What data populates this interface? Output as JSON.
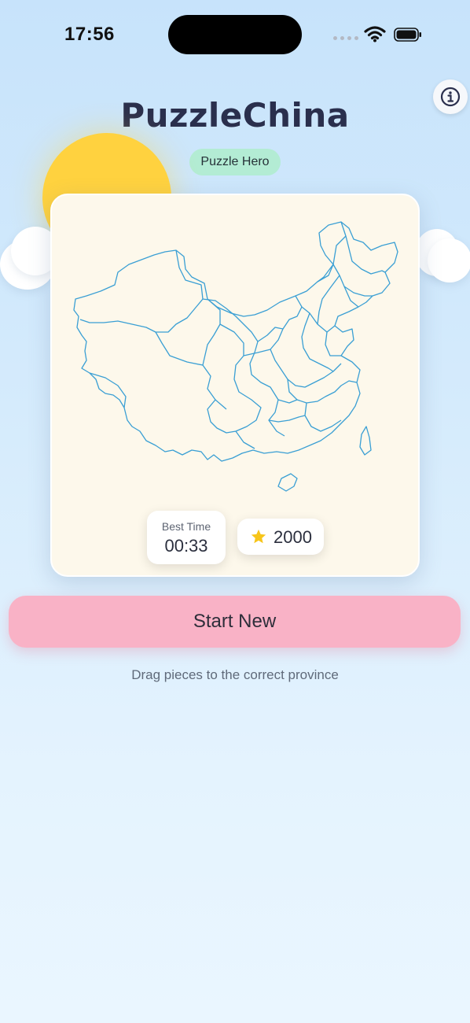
{
  "status_bar": {
    "time": "17:56"
  },
  "header": {
    "title": "PuzzleChina",
    "rank_badge": "Puzzle Hero"
  },
  "stats": {
    "best_time_label": "Best Time",
    "best_time_value": "00:33",
    "stars_value": "2000"
  },
  "actions": {
    "start_label": "Start New"
  },
  "hint": "Drag pieces to the correct province",
  "colors": {
    "background_top": "#c7e3fb",
    "sun": "#ffd23f",
    "card": "#fdf8eb",
    "badge": "#b3ecd4",
    "start_button": "#f9b2c6",
    "map_outline": "#3a9fd4"
  },
  "icons": [
    "info-icon",
    "star-icon",
    "wifi-icon",
    "battery-icon",
    "signal-icon"
  ]
}
